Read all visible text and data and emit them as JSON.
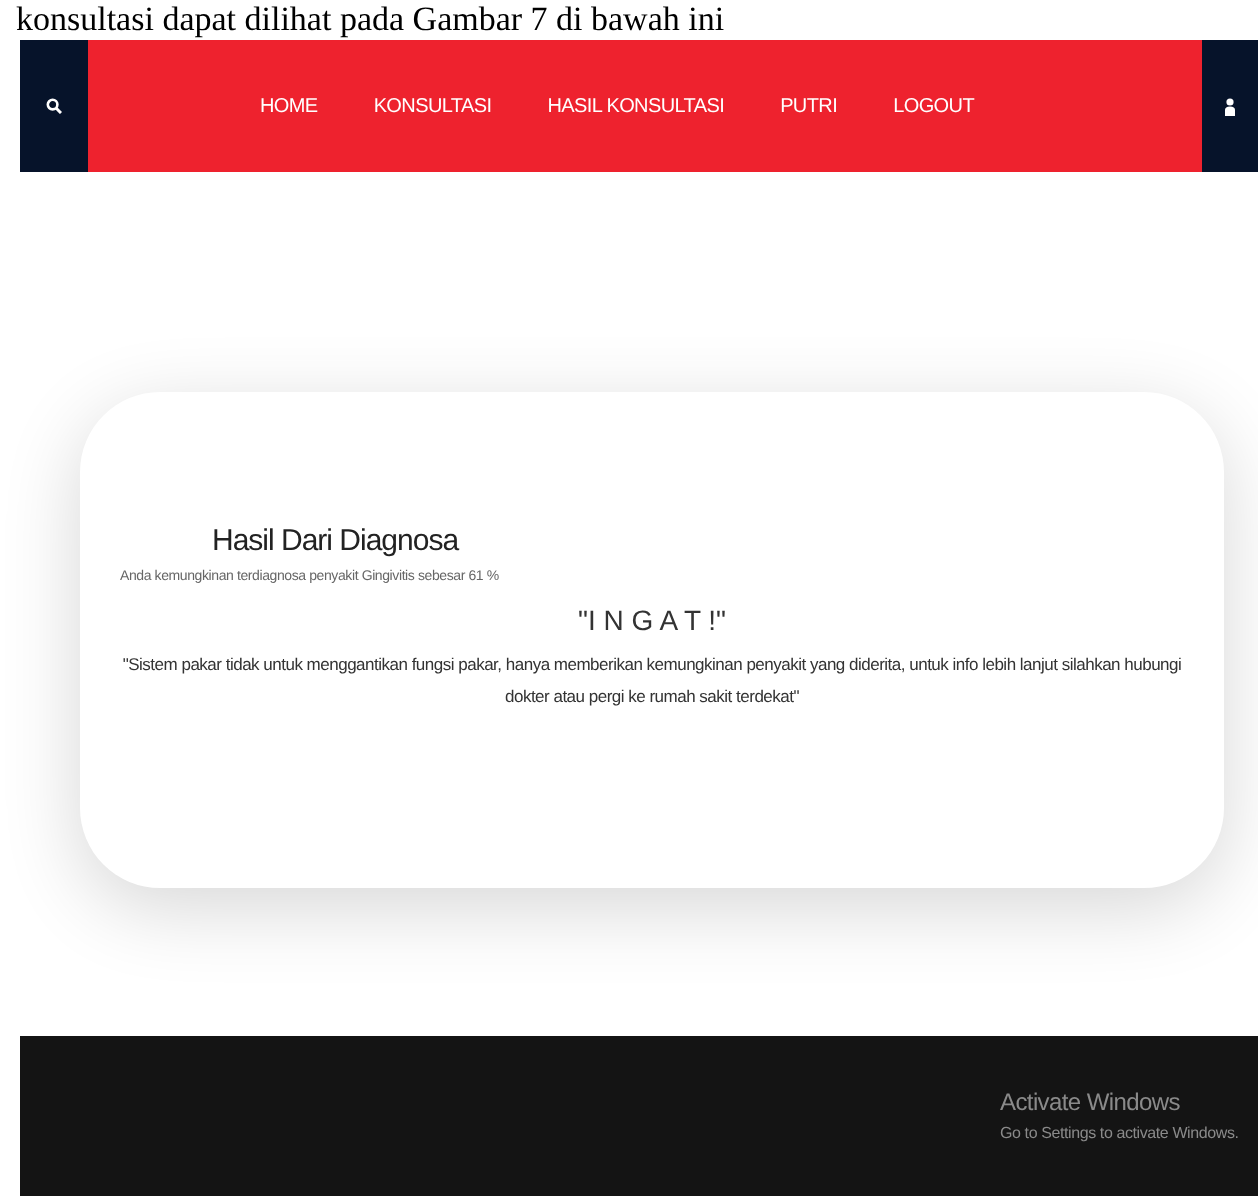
{
  "document_text": "konsultasi dapat dilihat pada Gambar 7 di bawah ini",
  "nav": {
    "items": [
      {
        "label": "HOME"
      },
      {
        "label": "KONSULTASI"
      },
      {
        "label": "HASIL KONSULTASI"
      },
      {
        "label": "PUTRI"
      },
      {
        "label": "LOGOUT"
      }
    ]
  },
  "result": {
    "title": "Hasil Dari Diagnosa",
    "summary": "Anda kemungkinan terdiagnosa penyakit Gingivitis sebesar 61 %",
    "warning_title": "\"I N G A T !\"",
    "warning_text": "\"Sistem pakar tidak untuk menggantikan fungsi pakar, hanya memberikan kemungkinan penyakit yang diderita, untuk info lebih lanjut silahkan hubungi dokter atau pergi ke rumah sakit terdekat\""
  },
  "os_notice": {
    "title": "Activate Windows",
    "text": "Go to Settings to activate Windows."
  }
}
